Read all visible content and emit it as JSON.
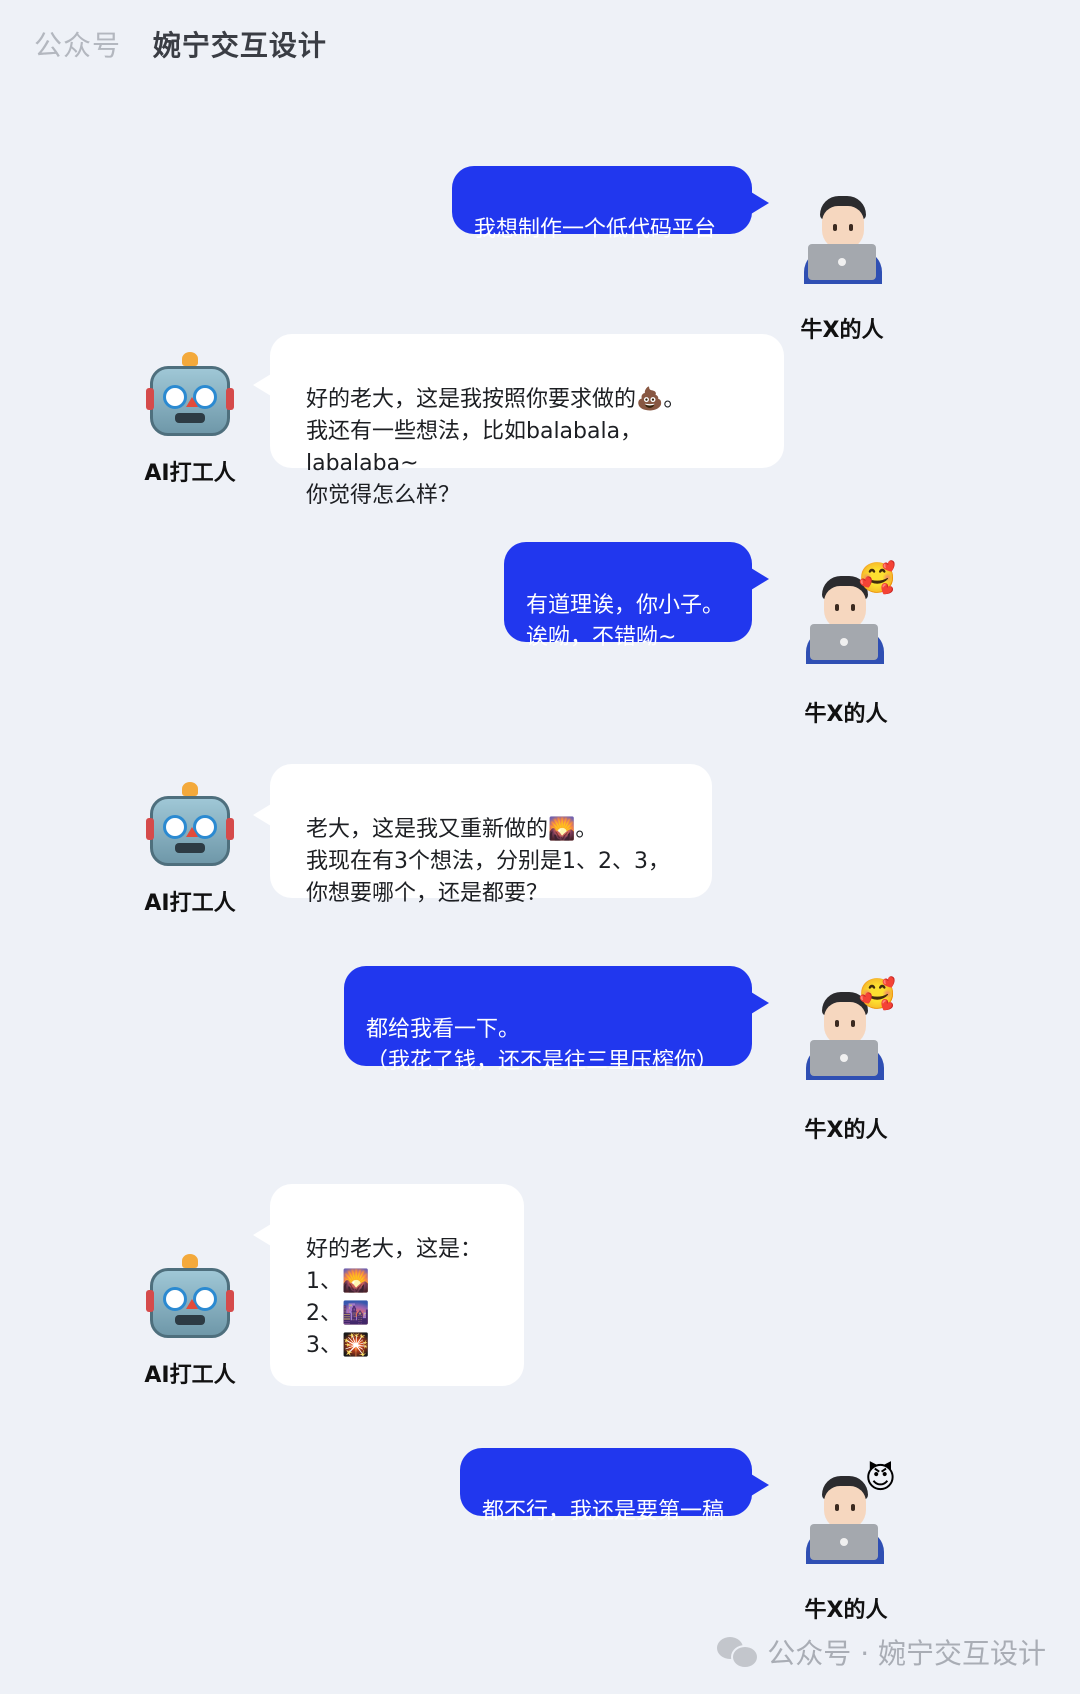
{
  "header": {
    "label": "公众号",
    "account_name": "婉宁交互设计"
  },
  "participants": {
    "user_name": "牛X的人",
    "ai_name": "AI打工人"
  },
  "messages": [
    {
      "from": "user",
      "text": "我想制作一个低代码平台"
    },
    {
      "from": "ai",
      "text": "好的老大，这是我按照你要求做的💩。\n我还有一些想法，比如balabala，labalaba~\n你觉得怎么样？"
    },
    {
      "from": "user",
      "text": "有道理诶，你小子。\n诶呦，不错呦~",
      "avatar_emoji": "🥰"
    },
    {
      "from": "ai",
      "text": "老大，这是我又重新做的🌄。\n我现在有3个想法，分别是1、2、3，\n你想要哪个，还是都要？"
    },
    {
      "from": "user",
      "text": "都给我看一下。\n（我花了钱，还不是往三里压榨你）",
      "avatar_emoji": "🥰"
    },
    {
      "from": "ai",
      "text": "好的老大，这是：\n1、🌄\n2、🌆\n3、🎇"
    },
    {
      "from": "user",
      "text": "都不行，我还是要第一稿",
      "avatar_emoji": "😈"
    }
  ],
  "footer": {
    "text": "公众号 · 婉宁交互设计",
    "icon": "wechat-icon"
  }
}
